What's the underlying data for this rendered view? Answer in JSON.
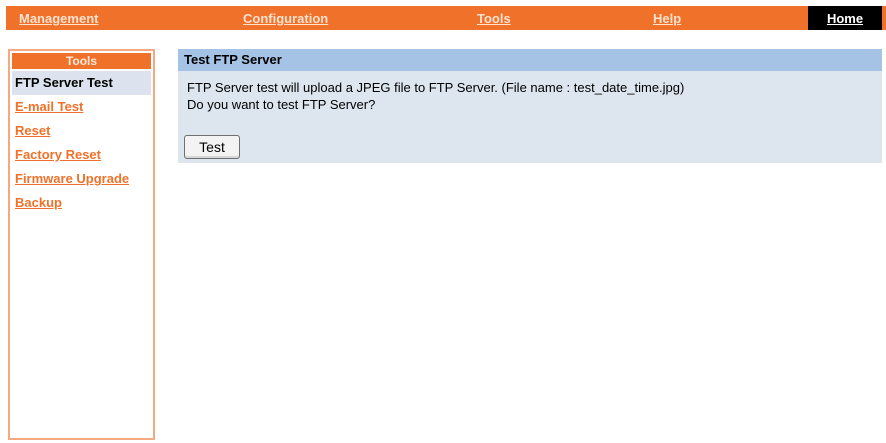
{
  "topnav": {
    "management": "Management",
    "configuration": "Configuration",
    "tools": "Tools",
    "help": "Help",
    "home": "Home"
  },
  "sidebar": {
    "title": "Tools",
    "items": [
      {
        "label": "FTP Server Test"
      },
      {
        "label": "E-mail Test"
      },
      {
        "label": "Reset"
      },
      {
        "label": "Factory Reset"
      },
      {
        "label": "Firmware Upgrade"
      },
      {
        "label": "Backup"
      }
    ]
  },
  "main": {
    "title": "Test FTP Server",
    "line1": "FTP Server test will upload a JPEG file to FTP Server. (File name : test_date_time.jpg)",
    "line2": "Do you want to test FTP Server?",
    "button": "Test"
  },
  "colors": {
    "accent": "#f0722a",
    "panel_header": "#a5c3e5",
    "panel_body": "#dde6ef"
  }
}
